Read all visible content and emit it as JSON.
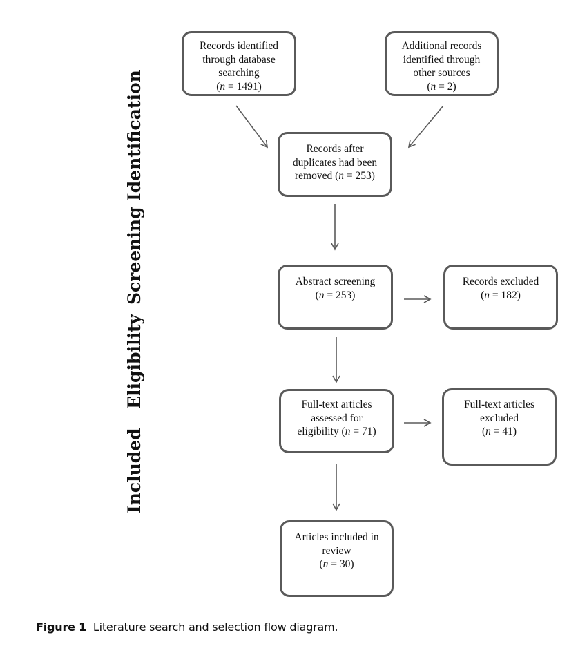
{
  "stages": {
    "identification": "Identification",
    "screening": "Screening",
    "eligibility": "Eligibility",
    "included": "Included"
  },
  "boxes": {
    "database_search": {
      "lines": [
        "Records identified",
        "through database",
        "searching"
      ],
      "n_label": "n",
      "n_value": "1491"
    },
    "other_sources": {
      "lines": [
        "Additional records",
        "identified through",
        "other sources"
      ],
      "n_label": "n",
      "n_value": "2"
    },
    "after_duplicates": {
      "lines": [
        "Records after",
        "duplicates had been",
        "removed"
      ],
      "n_label": "n",
      "n_value": "253"
    },
    "abstract_screening": {
      "lines": [
        "Abstract screening"
      ],
      "n_label": "n",
      "n_value": "253"
    },
    "records_excluded": {
      "lines": [
        "Records excluded"
      ],
      "n_label": "n",
      "n_value": "182"
    },
    "fulltext_assessed": {
      "lines": [
        "Full-text articles",
        "assessed for",
        "eligibility"
      ],
      "n_label": "n",
      "n_value": "71"
    },
    "fulltext_excluded": {
      "lines": [
        "Full-text articles",
        "excluded"
      ],
      "n_label": "n",
      "n_value": "41"
    },
    "included_review": {
      "lines": [
        "Articles included in",
        "review"
      ],
      "n_label": "n",
      "n_value": "30"
    }
  },
  "caption": {
    "label": "Figure 1",
    "text": "Literature search and selection flow diagram."
  },
  "colors": {
    "box_border": "#5a5a5a",
    "arrow": "#5a5a5a",
    "text": "#111111"
  }
}
